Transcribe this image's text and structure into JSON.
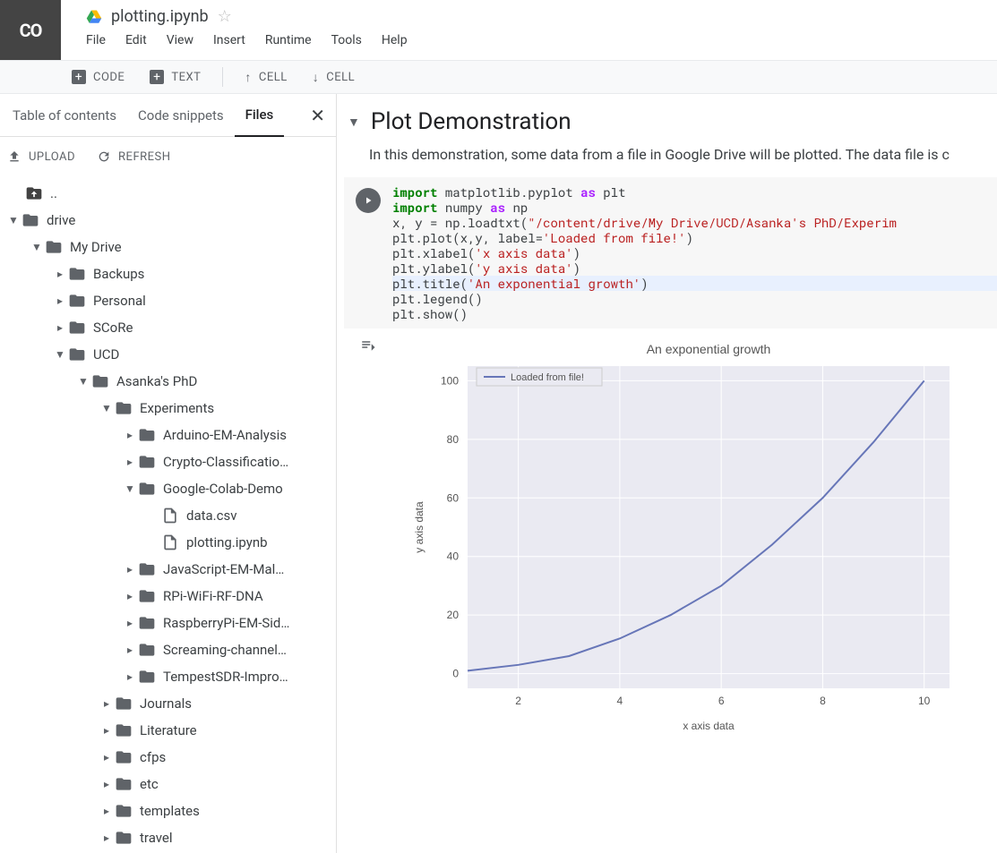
{
  "header": {
    "logo_text": "CO",
    "doc_title": "plotting.ipynb",
    "menu": [
      "File",
      "Edit",
      "View",
      "Insert",
      "Runtime",
      "Tools",
      "Help"
    ]
  },
  "toolbar": {
    "code": "CODE",
    "text": "TEXT",
    "cell_up": "CELL",
    "cell_down": "CELL"
  },
  "sidebar": {
    "tabs": [
      "Table of contents",
      "Code snippets",
      "Files"
    ],
    "active_tab": 2,
    "upload": "UPLOAD",
    "refresh": "REFRESH",
    "up_label": "..",
    "tree": [
      {
        "d": 0,
        "exp": "down",
        "t": "folder",
        "l": "drive"
      },
      {
        "d": 1,
        "exp": "down",
        "t": "folder",
        "l": "My Drive"
      },
      {
        "d": 2,
        "exp": "right",
        "t": "folder",
        "l": "Backups"
      },
      {
        "d": 2,
        "exp": "right",
        "t": "folder",
        "l": "Personal"
      },
      {
        "d": 2,
        "exp": "right",
        "t": "folder",
        "l": "SCoRe"
      },
      {
        "d": 2,
        "exp": "down",
        "t": "folder",
        "l": "UCD"
      },
      {
        "d": 3,
        "exp": "down",
        "t": "folder",
        "l": "Asanka's PhD"
      },
      {
        "d": 4,
        "exp": "down",
        "t": "folder",
        "l": "Experiments"
      },
      {
        "d": 5,
        "exp": "right",
        "t": "folder",
        "l": "Arduino-EM-Analysis"
      },
      {
        "d": 5,
        "exp": "right",
        "t": "folder",
        "l": "Crypto-Classificatio…"
      },
      {
        "d": 5,
        "exp": "down",
        "t": "folder",
        "l": "Google-Colab-Demo"
      },
      {
        "d": 6,
        "exp": "",
        "t": "file",
        "l": "data.csv"
      },
      {
        "d": 6,
        "exp": "",
        "t": "file",
        "l": "plotting.ipynb"
      },
      {
        "d": 5,
        "exp": "right",
        "t": "folder",
        "l": "JavaScript-EM-Mal…"
      },
      {
        "d": 5,
        "exp": "right",
        "t": "folder",
        "l": "RPi-WiFi-RF-DNA"
      },
      {
        "d": 5,
        "exp": "right",
        "t": "folder",
        "l": "RaspberryPi-EM-Sid…"
      },
      {
        "d": 5,
        "exp": "right",
        "t": "folder",
        "l": "Screaming-channel…"
      },
      {
        "d": 5,
        "exp": "right",
        "t": "folder",
        "l": "TempestSDR-Impro…"
      },
      {
        "d": 4,
        "exp": "right",
        "t": "folder",
        "l": "Journals"
      },
      {
        "d": 4,
        "exp": "right",
        "t": "folder",
        "l": "Literature"
      },
      {
        "d": 4,
        "exp": "right",
        "t": "folder",
        "l": "cfps"
      },
      {
        "d": 4,
        "exp": "right",
        "t": "folder",
        "l": "etc"
      },
      {
        "d": 4,
        "exp": "right",
        "t": "folder",
        "l": "templates"
      },
      {
        "d": 4,
        "exp": "right",
        "t": "folder",
        "l": "travel"
      }
    ]
  },
  "notebook": {
    "section_title": "Plot Demonstration",
    "section_text": "In this demonstration, some data from a file in Google Drive will be plotted. The data file is c",
    "code_lines": [
      {
        "segs": [
          {
            "c": "kw",
            "t": "import"
          },
          {
            "t": " matplotlib.pyplot "
          },
          {
            "c": "kw2",
            "t": "as"
          },
          {
            "t": " plt"
          }
        ]
      },
      {
        "segs": [
          {
            "c": "kw",
            "t": "import"
          },
          {
            "t": " numpy "
          },
          {
            "c": "kw2",
            "t": "as"
          },
          {
            "t": " np"
          }
        ]
      },
      {
        "segs": [
          {
            "t": ""
          }
        ]
      },
      {
        "segs": [
          {
            "t": "x, y = np.loadtxt("
          },
          {
            "c": "str",
            "t": "\"/content/drive/My Drive/UCD/Asanka's PhD/Experim"
          }
        ]
      },
      {
        "segs": [
          {
            "t": "plt.plot(x,y, label="
          },
          {
            "c": "str",
            "t": "'Loaded from file!'"
          },
          {
            "t": ")"
          }
        ]
      },
      {
        "segs": [
          {
            "t": ""
          }
        ]
      },
      {
        "segs": [
          {
            "t": "plt.xlabel("
          },
          {
            "c": "str",
            "t": "'x axis data'"
          },
          {
            "t": ")"
          }
        ]
      },
      {
        "segs": [
          {
            "t": "plt.ylabel("
          },
          {
            "c": "str",
            "t": "'y axis data'"
          },
          {
            "t": ")"
          }
        ]
      },
      {
        "hl": true,
        "segs": [
          {
            "t": "plt.title("
          },
          {
            "c": "str",
            "t": "'An exponential growth'"
          },
          {
            "t": ")"
          }
        ]
      },
      {
        "segs": [
          {
            "t": "plt.legend()"
          }
        ]
      },
      {
        "segs": [
          {
            "t": "plt.show()"
          }
        ]
      }
    ]
  },
  "chart_data": {
    "type": "line",
    "title": "An exponential growth",
    "xlabel": "x axis data",
    "ylabel": "y axis data",
    "legend": "Loaded from file!",
    "x_ticks": [
      2,
      4,
      6,
      8,
      10
    ],
    "y_ticks": [
      0,
      20,
      40,
      60,
      80,
      100
    ],
    "xlim": [
      1,
      10.5
    ],
    "ylim": [
      -5,
      105
    ],
    "series": [
      {
        "name": "Loaded from file!",
        "x": [
          1,
          2,
          3,
          4,
          5,
          6,
          7,
          8,
          9,
          10
        ],
        "y": [
          1,
          3,
          6,
          12,
          20,
          30,
          44,
          60,
          79,
          100
        ]
      }
    ]
  }
}
